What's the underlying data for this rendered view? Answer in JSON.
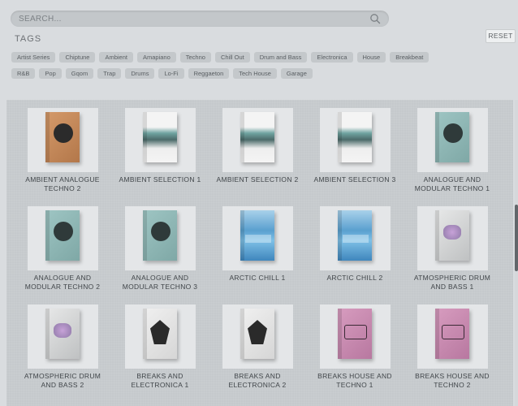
{
  "search": {
    "placeholder": "SEARCH..."
  },
  "tags": {
    "title": "TAGS",
    "reset_label": "RESET",
    "row1": [
      "Artist Series",
      "Chiptune",
      "Ambient",
      "Amapiano",
      "Techno",
      "Chill Out",
      "Drum and Bass",
      "Electronica",
      "House",
      "Breakbeat"
    ],
    "row2": [
      "R&B",
      "Pop",
      "Gqom",
      "Trap",
      "Drums",
      "Lo-Fi",
      "Reggaeton",
      "Tech House",
      "Garage"
    ]
  },
  "products": [
    {
      "label": "AMBIENT ANALOGUE TECHNO 2",
      "art": "orange"
    },
    {
      "label": "AMBIENT SELECTION 1",
      "art": "landscape"
    },
    {
      "label": "AMBIENT SELECTION 2",
      "art": "landscape"
    },
    {
      "label": "AMBIENT SELECTION 3",
      "art": "landscape"
    },
    {
      "label": "ANALOGUE AND MODULAR TECHNO 1",
      "art": "teal"
    },
    {
      "label": "ANALOGUE AND MODULAR TECHNO 2",
      "art": "teal"
    },
    {
      "label": "ANALOGUE AND MODULAR TECHNO 3",
      "art": "teal"
    },
    {
      "label": "ARCTIC CHILL 1",
      "art": "blue"
    },
    {
      "label": "ARCTIC CHILL 2",
      "art": "blue"
    },
    {
      "label": "ATMOSPHERIC DRUM AND BASS 1",
      "art": "grey"
    },
    {
      "label": "ATMOSPHERIC DRUM AND BASS 2",
      "art": "grey"
    },
    {
      "label": "BREAKS AND ELECTRONICA 1",
      "art": "dark-poly"
    },
    {
      "label": "BREAKS AND ELECTRONICA 2",
      "art": "dark-poly"
    },
    {
      "label": "BREAKS HOUSE AND TECHNO 1",
      "art": "pink"
    },
    {
      "label": "BREAKS HOUSE AND TECHNO 2",
      "art": "pink"
    }
  ],
  "colors": {
    "page_bg": "#d9dcdf",
    "panel_bg": "#c5c9cc",
    "tag_bg": "#c4c8cb",
    "scroll_thumb": "#62676b"
  }
}
